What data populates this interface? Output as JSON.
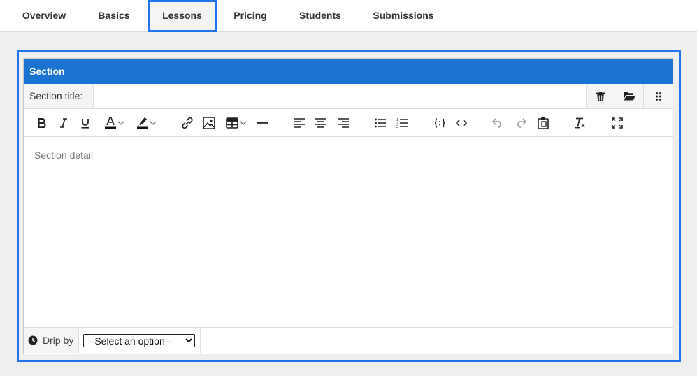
{
  "tabs": [
    {
      "label": "Overview"
    },
    {
      "label": "Basics"
    },
    {
      "label": "Lessons",
      "active": true
    },
    {
      "label": "Pricing"
    },
    {
      "label": "Students"
    },
    {
      "label": "Submissions"
    }
  ],
  "section": {
    "header": "Section",
    "title_label": "Section title:",
    "title_value": "",
    "actions": [
      "trash-icon",
      "folder-open-icon",
      "drag-handle-icon"
    ],
    "detail_placeholder": "Section detail"
  },
  "toolbar": {
    "buttons": [
      "bold",
      "italic",
      "underline",
      "text-color",
      "highlight-color",
      "link",
      "image",
      "table",
      "horizontal-rule",
      "align-left",
      "align-center",
      "align-right",
      "bullet-list",
      "numbered-list",
      "code-block",
      "source-code",
      "undo",
      "redo",
      "paste",
      "clear-formatting",
      "fullscreen"
    ]
  },
  "drip": {
    "label": "Drip by",
    "selected": "--Select an option--"
  },
  "colors": {
    "accent": "#1b75d0",
    "highlight_frame": "#1f74f0"
  }
}
